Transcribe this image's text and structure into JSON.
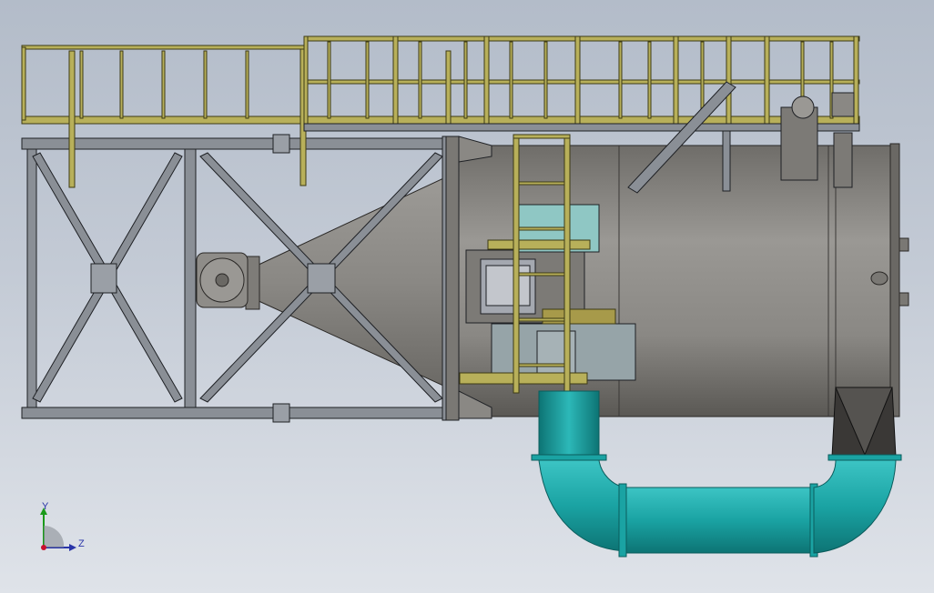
{
  "viewport": {
    "background_top": "#b3bcc9",
    "background_bottom": "#dfe3e9"
  },
  "model": {
    "colors": {
      "railing": "#b8b05a",
      "railing_edge": "#3d3a14",
      "frame_steel": "#8a8f96",
      "frame_edge": "#1e2024",
      "shell": "#8c8a86",
      "shell_dark": "#55534f",
      "duct": "#1aa3a3",
      "duct_dark": "#0b5c5c",
      "window_glass": "#8fc7c4"
    }
  },
  "triad": {
    "y_label": "Y",
    "z_label": "Z",
    "y_color": "#1a9a1a",
    "z_color": "#2a35a8",
    "origin_color": "#c8102e"
  }
}
